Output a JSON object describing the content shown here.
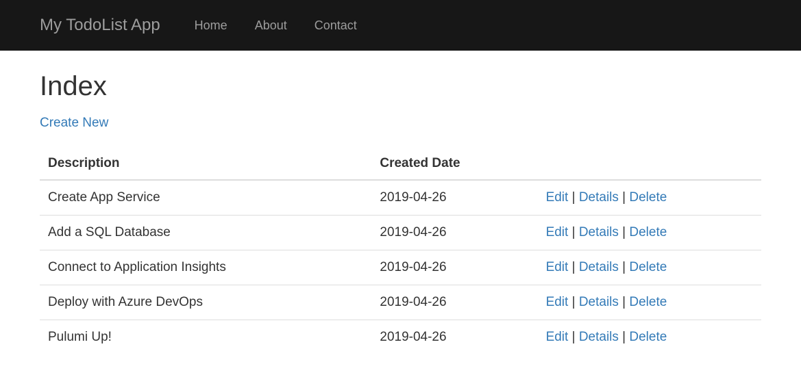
{
  "navbar": {
    "brand": "My TodoList App",
    "links": [
      {
        "label": "Home"
      },
      {
        "label": "About"
      },
      {
        "label": "Contact"
      }
    ]
  },
  "page": {
    "title": "Index",
    "create_label": "Create New"
  },
  "table": {
    "headers": {
      "description": "Description",
      "created_date": "Created Date"
    },
    "actions": {
      "edit": "Edit",
      "details": "Details",
      "delete": "Delete"
    },
    "rows": [
      {
        "description": "Create App Service",
        "created_date": "2019-04-26"
      },
      {
        "description": "Add a SQL Database",
        "created_date": "2019-04-26"
      },
      {
        "description": "Connect to Application Insights",
        "created_date": "2019-04-26"
      },
      {
        "description": "Deploy with Azure DevOps",
        "created_date": "2019-04-26"
      },
      {
        "description": "Pulumi Up!",
        "created_date": "2019-04-26"
      }
    ]
  }
}
